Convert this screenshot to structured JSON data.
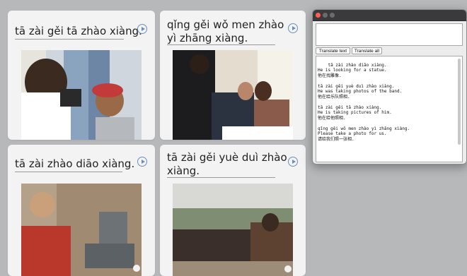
{
  "cards": [
    {
      "title": "tā zài gěi tā zhào xiàng.",
      "photo": "photographer-taking-picture-of-man-and-woman"
    },
    {
      "title_l1": "qǐng gěi wǒ men zhào",
      "title_l2": "yì zhāng xiàng.",
      "photo": "waiter-photographing-couple-at-restaurant"
    },
    {
      "title": "tā zài zhào diāo xiàng.",
      "photo": "woman-photographing-statue"
    },
    {
      "title_l1": "tā zài gěi yuè duì zhào",
      "title_l2": "xiàng.",
      "photo": "man-photographing-band"
    }
  ],
  "translator": {
    "input_value": "",
    "translate_text_label": "Translate text",
    "translate_all_label": "Translate all",
    "output_text": "tā zài zhào diāo xiàng.\nHe is looking for a statue.\n他在找雕像.\n\ntā zài gěi yuè duì zhào xiàng.\nHe was taking photos of the band.\n他在给乐队照相.\n\ntā zài gěi tā zhào xiàng.\nHe is taking pictures of him.\n他在给他照相.\n\nqǐng gěi wǒ men zhào yì zhāng xiàng.\nPlease take a photo for us.\n请给我们照一张相."
  },
  "colors": {
    "play_icon": "#6b8fb6",
    "page_bg": "#b7b8ba",
    "card_bg": "#f3f3f4"
  }
}
